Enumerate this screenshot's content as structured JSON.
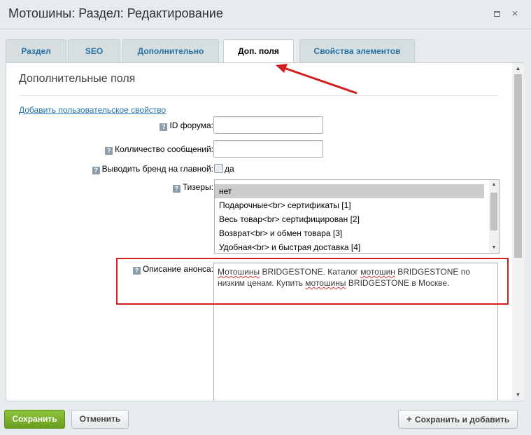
{
  "window": {
    "title": "Мотошины: Раздел: Редактирование",
    "maximize_icon": "maximize-icon",
    "close_icon": "close-icon",
    "close_glyph": "×"
  },
  "tabs": [
    {
      "label": "Раздел",
      "active": false
    },
    {
      "label": "SEO",
      "active": false
    },
    {
      "label": "Дополнительно",
      "active": false
    },
    {
      "label": "Доп. поля",
      "active": true
    },
    {
      "label": "Свойства элементов",
      "active": false
    }
  ],
  "section": {
    "title": "Дополнительные поля",
    "add_link": "Добавить пользовательское свойство"
  },
  "fields": {
    "hint_glyph": "?",
    "forum_id": {
      "label": "ID форума:",
      "value": ""
    },
    "messages_count": {
      "label": "Колличество сообщений:",
      "value": ""
    },
    "brand_on_main": {
      "label": "Выводить бренд на главной:",
      "checkbox_label": "да",
      "checked": false
    },
    "teasers": {
      "label": "Тизеры:",
      "options": [
        "нет",
        "Подарочные<br> сертификаты [1]",
        "Весь товар<br> сертифицирован [2]",
        "Возврат<br> и обмен товара [3]",
        "Удобная<br> и быстрая доставка [4]"
      ],
      "selected_index": 0
    },
    "announce": {
      "label": "Описание анонса:",
      "parts": [
        "Мотошины",
        " BRIDGESTONE. Каталог ",
        "мотошин",
        " BRIDGESTONE по низким ценам. Купить ",
        "мотошины",
        " BRIDGESTONE в Москве."
      ]
    }
  },
  "footer": {
    "save": "Сохранить",
    "cancel": "Отменить",
    "save_add": "Сохранить и добавить",
    "plus_glyph": "+"
  },
  "colors": {
    "accent_link": "#2673a7",
    "save_green": "#6a9d1f",
    "highlight_red": "#d21f1f"
  }
}
